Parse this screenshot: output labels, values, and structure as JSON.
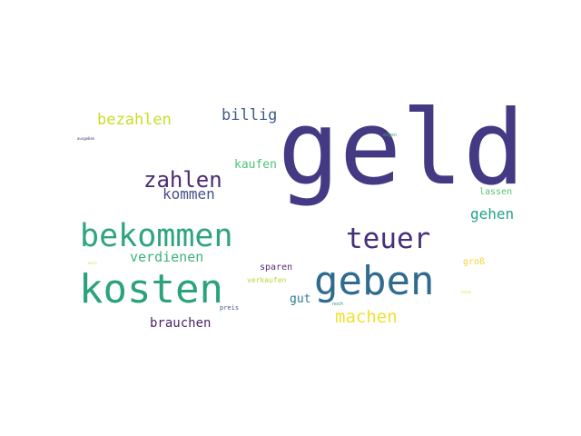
{
  "wordcloud": {
    "words": [
      {
        "text": "geld",
        "color": "#443a83"
      },
      {
        "text": "kosten",
        "color": "#2aa37a"
      },
      {
        "text": "geben",
        "color": "#2f6b8e"
      },
      {
        "text": "bekommen",
        "color": "#2ea57e"
      },
      {
        "text": "teuer",
        "color": "#45307b"
      },
      {
        "text": "zahlen",
        "color": "#4b2b72"
      },
      {
        "text": "machen",
        "color": "#f2e12f"
      },
      {
        "text": "bezahlen",
        "color": "#c5df26"
      },
      {
        "text": "billig",
        "color": "#3e5a8c"
      },
      {
        "text": "kommen",
        "color": "#46508a"
      },
      {
        "text": "verdienen",
        "color": "#3fb27c"
      },
      {
        "text": "gehen",
        "color": "#26a08a"
      },
      {
        "text": "kaufen",
        "color": "#50c278"
      },
      {
        "text": "brauchen",
        "color": "#4d2466"
      },
      {
        "text": "gut",
        "color": "#2f7a8e"
      },
      {
        "text": "sparen",
        "color": "#5a2a6e"
      },
      {
        "text": "lassen",
        "color": "#56c56c"
      },
      {
        "text": "groß",
        "color": "#f0d537"
      },
      {
        "text": "verkaufen",
        "color": "#b8d93a"
      },
      {
        "text": "preis",
        "color": "#3a5b8c"
      },
      {
        "text": "noch",
        "color": "#1f8f8a"
      },
      {
        "text": "eigen",
        "color": "#3aa67a"
      },
      {
        "text": "ausgeben",
        "color": "#3b2f7d"
      },
      {
        "text": "euro",
        "color": "#d4e040"
      },
      {
        "text": "leute",
        "color": "#e8dd3a"
      }
    ]
  }
}
